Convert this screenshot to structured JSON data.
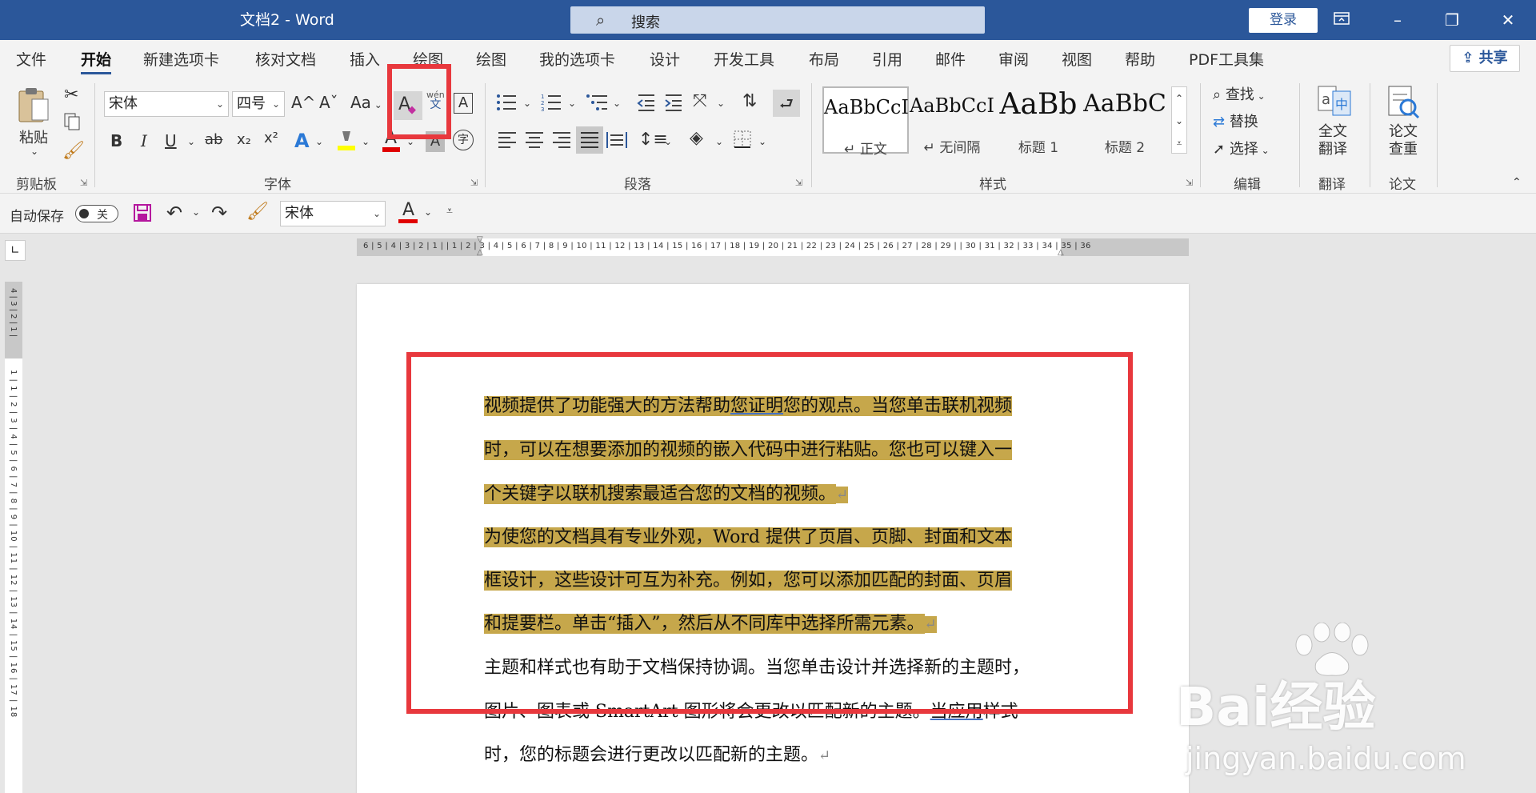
{
  "window": {
    "title": "文档2 - Word",
    "login": "登录"
  },
  "search": {
    "label": "搜索"
  },
  "menu": {
    "tabs": [
      "文件",
      "开始",
      "新建选项卡",
      "核对文档",
      "插入",
      "绘图",
      "绘图",
      "我的选项卡",
      "设计",
      "开发工具",
      "布局",
      "引用",
      "邮件",
      "审阅",
      "视图",
      "帮助",
      "PDF工具集"
    ],
    "active_index": 1,
    "share": "共享"
  },
  "ribbon": {
    "clipboard": {
      "paste": "粘贴",
      "group": "剪贴板"
    },
    "font": {
      "name": "宋体",
      "size": "四号",
      "group": "字体",
      "grow": "A^",
      "shrink": "Aˇ",
      "case": "Aa",
      "clear_format": "A",
      "phonetic_top": "wén",
      "phonetic_bottom": "文",
      "border": "A",
      "bold": "B",
      "italic": "I",
      "underline": "U",
      "strike": "ab",
      "subscript": "x₂",
      "superscript": "x²",
      "text_effect": "A",
      "font_color": "A",
      "char_shade": "A",
      "enclose": "字"
    },
    "paragraph": {
      "group": "段落"
    },
    "styles": {
      "group": "样式",
      "items": [
        {
          "preview": "AaBbCcI",
          "name": "↵ 正文"
        },
        {
          "preview": "AaBbCcI",
          "name": "↵ 无间隔"
        },
        {
          "preview": "AaBb",
          "name": "标题 1"
        },
        {
          "preview": "AaBbC",
          "name": "标题 2"
        }
      ]
    },
    "editing": {
      "find": "查找",
      "replace": "替换",
      "select": "选择",
      "group": "编辑"
    },
    "translate": {
      "label": "全文\n翻译",
      "line1": "全文",
      "line2": "翻译",
      "group": "翻译"
    },
    "paper": {
      "line1": "论文",
      "line2": "查重",
      "group": "论文"
    }
  },
  "qat": {
    "autosave": "自动保存",
    "toggle": "关",
    "font": "宋体",
    "font_color": "A"
  },
  "ruler": {
    "horizontal": "6 | 5 | 4 | 3 | 2 | 1 |     | 1 | 2 | 3 | 4 | 5 | 6 | 7 | 8 | 9 | 10 | 11 | 12 | 13 | 14 | 15 | 16 | 17 | 18 | 19 | 20 | 21 | 22 | 23 | 24 | 25 | 26 | 27 | 28 | 29 |     | 30 | 31 | 32 | 33 | 34 | 35 | 36",
    "vertical_top": "4 | 3 | 2 | 1 |",
    "vertical": "1 | 1 | 2 | 3 | 4 | 5 | 6 | 7 | 8 | 9 | 10 | 11 | 12 | 13 | 14 | 15 | 16 | 17 | 18"
  },
  "document": {
    "lines": [
      {
        "pre": "视频提供了功能强大的方法帮助",
        "ul": "您证明",
        "post": "您的观点。当您单击联机视频"
      },
      {
        "text": "时，可以在想要添加的视频的嵌入代码中进行粘贴。您也可以键入一"
      },
      {
        "text": "个关键字以联机搜索最适合您的文档的视频。",
        "mark": "↵"
      },
      {
        "text": "为使您的文档具有专业外观，Word 提供了页眉、页脚、封面和文本"
      },
      {
        "text": "框设计，这些设计可互为补充。例如，您可以添加匹配的封面、页眉"
      },
      {
        "text": "和提要栏。单击“插入”，然后从不同库中选择所需元素。",
        "mark": "↵"
      },
      {
        "text": "主题和样式也有助于文档保持协调。当您单击设计并选择新的主题时，"
      },
      {
        "pre": "图片、图表或 SmartArt 图形将会更改以匹配新的主题。",
        "ul": "当应用",
        "post": "样式"
      },
      {
        "text": "时，您的标题会进行更改以匹配新的主题。",
        "mark": "↵"
      }
    ]
  },
  "watermark": {
    "logo": "Bai经验",
    "url": "jingyan.baidu.com"
  },
  "colors": {
    "title_bar": "#2b579a",
    "highlight": "#c6a74b",
    "highlight_light": "#ffd966",
    "annotation_red": "#e8383d"
  }
}
